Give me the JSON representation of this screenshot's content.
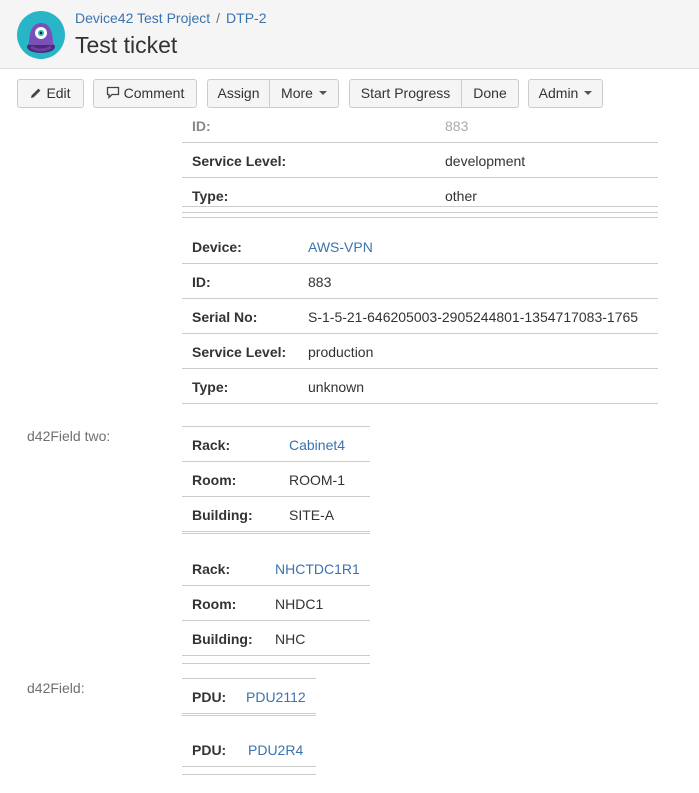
{
  "header": {
    "project": "Device42 Test Project",
    "separator": "/",
    "issue_key": "DTP-2",
    "title": "Test ticket"
  },
  "toolbar": {
    "edit": "Edit",
    "comment": "Comment",
    "assign": "Assign",
    "more": "More",
    "start_progress": "Start Progress",
    "done": "Done",
    "admin": "Admin"
  },
  "block1": {
    "partial_id_label": "ID:",
    "partial_id_value": "883",
    "rows": [
      {
        "label": "Service Level:",
        "value": "development"
      },
      {
        "label": "Type:",
        "value": "other"
      }
    ]
  },
  "block2": {
    "rows": [
      {
        "label": "Device:",
        "value": "AWS-VPN"
      },
      {
        "label": "ID:",
        "value": "883"
      },
      {
        "label": "Serial No:",
        "value": "S-1-5-21-646205003-2905244801-1354717083-1765"
      },
      {
        "label": "Service Level:",
        "value": "production"
      },
      {
        "label": "Type:",
        "value": "unknown"
      }
    ]
  },
  "field_two": {
    "label": "d42Field two:",
    "group1": [
      {
        "label": "Rack:",
        "value": "Cabinet4"
      },
      {
        "label": "Room:",
        "value": "ROOM-1"
      },
      {
        "label": "Building:",
        "value": "SITE-A"
      }
    ],
    "group2": [
      {
        "label": "Rack:",
        "value": "NHCTDC1R1"
      },
      {
        "label": "Room:",
        "value": "NHDC1"
      },
      {
        "label": "Building:",
        "value": "NHC"
      }
    ]
  },
  "field_one": {
    "label": "d42Field:",
    "group1": [
      {
        "label": "PDU:",
        "value": "PDU2112"
      }
    ],
    "group2": [
      {
        "label": "PDU:",
        "value": "PDU2R4"
      }
    ]
  },
  "colors": {
    "link": "#3b73af",
    "header_bg": "#f5f5f5",
    "avatar_ring": "#29b5c8",
    "avatar_body": "#6c3fa0"
  }
}
